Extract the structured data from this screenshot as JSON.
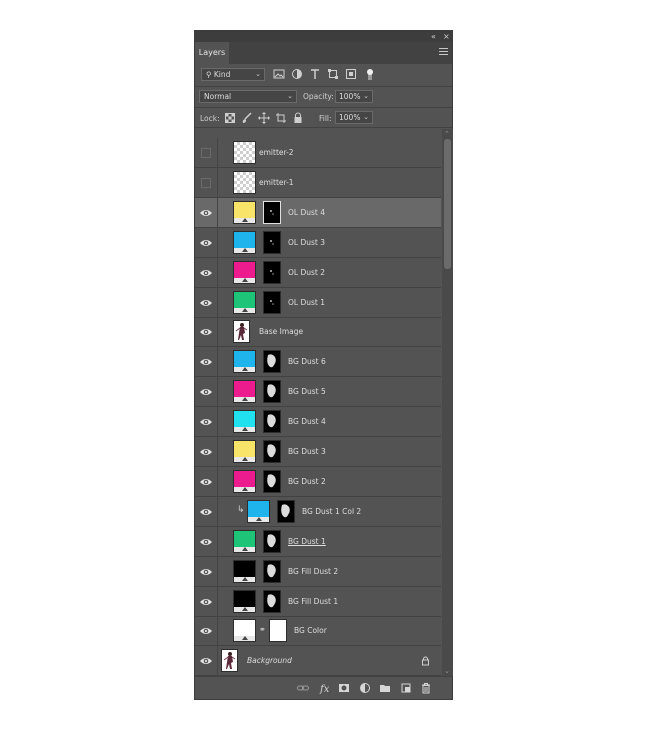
{
  "panel": {
    "tab_label": "Layers",
    "collapse_label": "«",
    "close_label": "×"
  },
  "filter": {
    "kind_label": "Kind",
    "blend_mode": "Normal",
    "opacity_label": "Opacity:",
    "opacity_value": "100%",
    "lock_label": "Lock:",
    "fill_label": "Fill:",
    "fill_value": "100%"
  },
  "layers": [
    {
      "name": "emitter-2",
      "visible": false,
      "thumb": "checker"
    },
    {
      "name": "emitter-1",
      "visible": false,
      "thumb": "checker"
    },
    {
      "name": "OL Dust 4",
      "visible": true,
      "color": "#f9e46a",
      "selected": true
    },
    {
      "name": "OL Dust 3",
      "visible": true,
      "color": "#1fb4ec"
    },
    {
      "name": "OL Dust 2",
      "visible": true,
      "color": "#ec1c8f"
    },
    {
      "name": "OL Dust 1",
      "visible": true,
      "color": "#1ec579"
    },
    {
      "name": "Base Image",
      "visible": true,
      "thumb": "image"
    },
    {
      "name": "BG Dust 6",
      "visible": true,
      "color": "#1fb4ec"
    },
    {
      "name": "BG Dust 5",
      "visible": true,
      "color": "#ec1c8f"
    },
    {
      "name": "BG Dust 4",
      "visible": true,
      "color": "#22e1ef"
    },
    {
      "name": "BG Dust 3",
      "visible": true,
      "color": "#f9e46a"
    },
    {
      "name": "BG Dust 2",
      "visible": true,
      "color": "#ec1c8f"
    },
    {
      "name": "BG Dust 1 Col 2",
      "visible": true,
      "color": "#1fb4ec",
      "clipped": true
    },
    {
      "name": "BG Dust 1",
      "visible": true,
      "color": "#1ec579",
      "underline": true
    },
    {
      "name": "BG Fill Dust 2",
      "visible": true,
      "color": "#000000"
    },
    {
      "name": "BG Fill Dust 1",
      "visible": true,
      "color": "#000000"
    },
    {
      "name": "BG Color",
      "visible": true,
      "color": "#ffffff",
      "linked": true
    },
    {
      "name": "Background",
      "visible": true,
      "thumb": "image",
      "italic": true,
      "locked": true
    }
  ],
  "colors": {
    "panel_bg": "#535353",
    "selected_row": "#696969",
    "header_bg": "#424242"
  },
  "icons": {
    "filter": [
      "image-filter-icon",
      "adjustment-filter-icon",
      "type-filter-icon",
      "shape-filter-icon",
      "smart-object-filter-icon",
      "filter-toggle-icon"
    ],
    "lock": [
      "lock-transparent-icon",
      "lock-pixels-icon",
      "lock-position-icon",
      "lock-artboard-icon",
      "lock-all-icon"
    ],
    "bottom": [
      "link-layers-icon",
      "fx-icon",
      "add-mask-icon",
      "new-adjustment-icon",
      "new-group-icon",
      "new-layer-icon",
      "delete-layer-icon"
    ]
  }
}
